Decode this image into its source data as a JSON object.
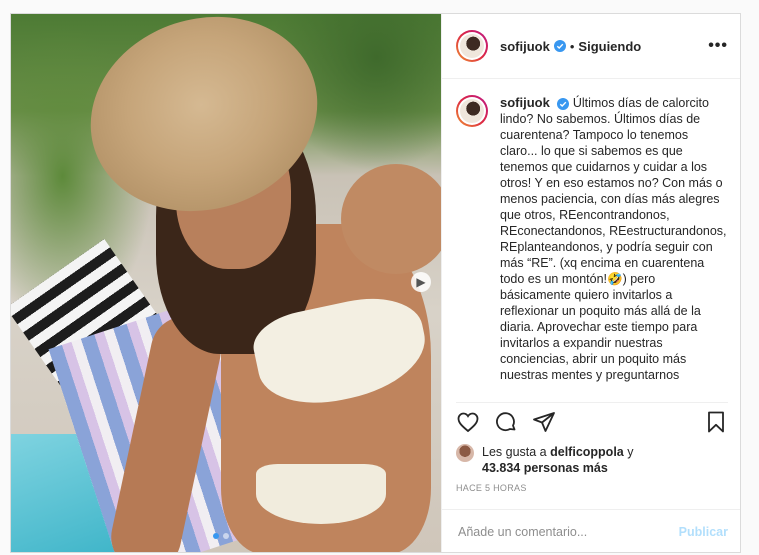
{
  "post": {
    "author": {
      "username": "sofijuok",
      "verified": true,
      "follow_status": "Siguiendo",
      "separator": "•"
    },
    "more_options_glyph": "•••",
    "caption": "Últimos días de calorcito lindo? No sabemos. Últimos días de cuarentena? Tampoco lo tenemos claro... lo que si sabemos es que tenemos que cuidarnos y cuidar a los otros! Y en eso estamos no? Con más o menos paciencia, con días más alegres que otros, REencontrandonos, REconectandonos, REestructurandonos, REplanteandonos, y podría seguir con más “RE”. (xq encima en cuarentena todo es un montón!🤣) pero básicamente quiero invitarlos a reflexionar un poquito más allá de la diaria. Aprovechar este tiempo para invitarlos a expandir nuestras conciencias, abrir un poquito más nuestras mentes y preguntarnos",
    "likes": {
      "prefix": "Les gusta a",
      "user": "delficoppola",
      "connector": "y",
      "others": "43.834 personas más"
    },
    "timestamp": "HACE 5 HORAS",
    "comment": {
      "placeholder": "Añade un comentario...",
      "publish_label": "Publicar"
    },
    "carousel": {
      "current": 1,
      "total": 2
    }
  },
  "icons": [
    "heart-icon",
    "comment-icon",
    "share-icon",
    "bookmark-icon",
    "verified-badge-icon",
    "next-arrow-icon"
  ],
  "colors": {
    "verified": "#3897f0",
    "publish_disabled": "#b2dffc",
    "active_dot": "#3897f0",
    "border": "#dbdbdb"
  }
}
